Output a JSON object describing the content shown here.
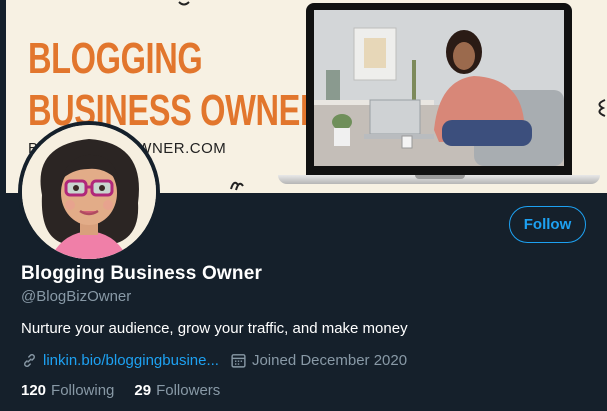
{
  "banner": {
    "title_line1": "BLOGGING",
    "title_line2": "BUSINESS OWNER",
    "url_text": "B▯▯▯▯▯NESSOWNER.COM"
  },
  "profile": {
    "display_name": "Blogging Business Owner",
    "handle": "@BlogBizOwner",
    "bio": "Nurture your audience, grow your traffic, and make money",
    "link_text": "linkin.bio/bloggingbusine...",
    "joined": "Joined December 2020"
  },
  "actions": {
    "follow_label": "Follow"
  },
  "stats": {
    "following_count": "120",
    "following_label": "Following",
    "followers_count": "29",
    "followers_label": "Followers"
  },
  "colors": {
    "background": "#15202b",
    "accent": "#1da1f2",
    "secondary_text": "#8899a6",
    "banner_orange": "#e2762d",
    "banner_bg": "#f7f1e3"
  },
  "icons": {
    "link": "link-icon",
    "calendar": "calendar-icon"
  }
}
